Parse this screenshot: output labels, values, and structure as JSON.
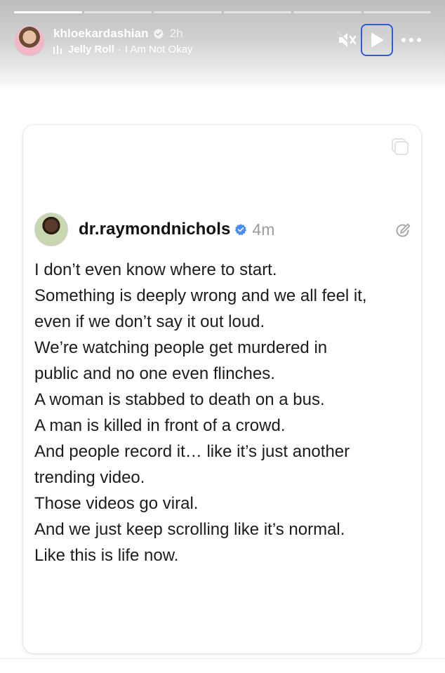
{
  "story": {
    "progress": [
      1,
      0,
      0,
      0,
      0,
      0
    ],
    "username": "khloekardashian",
    "time": "2h",
    "music": {
      "artist": "Jelly Roll",
      "separator": "·",
      "title": "I Am Not Okay"
    }
  },
  "post": {
    "username": "dr.raymondnichols",
    "time": "4m",
    "lines": [
      "I don’t even know where to start.",
      "Something is deeply wrong and we all feel it,",
      "even if we don’t say it out loud.",
      "We’re watching people get murdered in",
      "public and no one even flinches.",
      "A woman is stabbed to death on a bus.",
      "A man is killed in front of a crowd.",
      "And people record it… like it’s just another",
      "trending video.",
      "Those videos go viral.",
      "And we just keep scrolling like it’s normal.",
      "Like this is life now."
    ]
  },
  "icons": {
    "mute": "speaker-muted-icon",
    "play": "play-icon",
    "more": "more-icon",
    "verified": "verified-badge-icon",
    "copy": "duplicate-icon",
    "edit": "edit-icon",
    "music": "music-bars-icon"
  },
  "colors": {
    "verified": "#4a8df6",
    "focus_outline": "#2f5bd3"
  }
}
